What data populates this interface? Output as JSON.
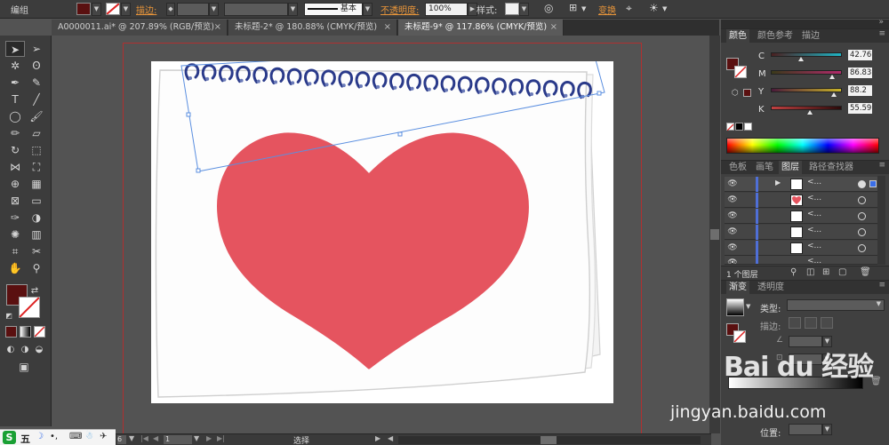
{
  "control_bar": {
    "mode_label": "编组",
    "stroke_label": "描边:",
    "stroke_style_label": "基本",
    "opacity_label": "不透明度:",
    "opacity_value": "100%",
    "style_label": "样式:",
    "transform_label": "变换",
    "fill_color": "#5a1010"
  },
  "tabs": [
    {
      "label": "A0000011.ai* @ 207.89% (RGB/预览)",
      "close": "×"
    },
    {
      "label": "未标题-2* @ 180.88% (CMYK/预览)",
      "close": "×"
    },
    {
      "label": "未标题-9* @ 117.86% (CMYK/预览)",
      "close": "×"
    }
  ],
  "color_panel": {
    "tabs": [
      "颜色",
      "颜色参考",
      "描边"
    ],
    "channels": [
      {
        "name": "C",
        "value": "42.76",
        "percent": 42.76,
        "track_color": "#1fb4c4"
      },
      {
        "name": "M",
        "value": "86.83",
        "percent": 86.83,
        "track_color": "#b12a6a"
      },
      {
        "name": "Y",
        "value": "88.2",
        "percent": 88.2,
        "track_color": "#c9b429"
      },
      {
        "name": "K",
        "value": "55.59",
        "percent": 55.59,
        "track_color": "#555555"
      }
    ]
  },
  "layers_panel": {
    "tabs": [
      "色板",
      "画笔",
      "图层",
      "路径查找器"
    ],
    "rows": [
      {
        "name": "<..."
      },
      {
        "name": "<..."
      },
      {
        "name": "<..."
      },
      {
        "name": "<..."
      },
      {
        "name": "<..."
      },
      {
        "name": "<..."
      }
    ],
    "footer": "1 个图层"
  },
  "gradient_panel": {
    "tabs": [
      "渐变",
      "透明度"
    ],
    "type_label": "类型:",
    "stroke_label": "描边:",
    "position_label": "位置:"
  },
  "status_bar": {
    "zoom": "6",
    "page": "1",
    "selection_label": "选择"
  },
  "taskbar": {
    "ime_label": "五"
  },
  "watermark": {
    "line1": "Bai du 经验",
    "line2": "jingyan.baidu.com"
  },
  "artwork": {
    "heart_color": "#e5545f",
    "ring_color": "#2a3a8a"
  }
}
